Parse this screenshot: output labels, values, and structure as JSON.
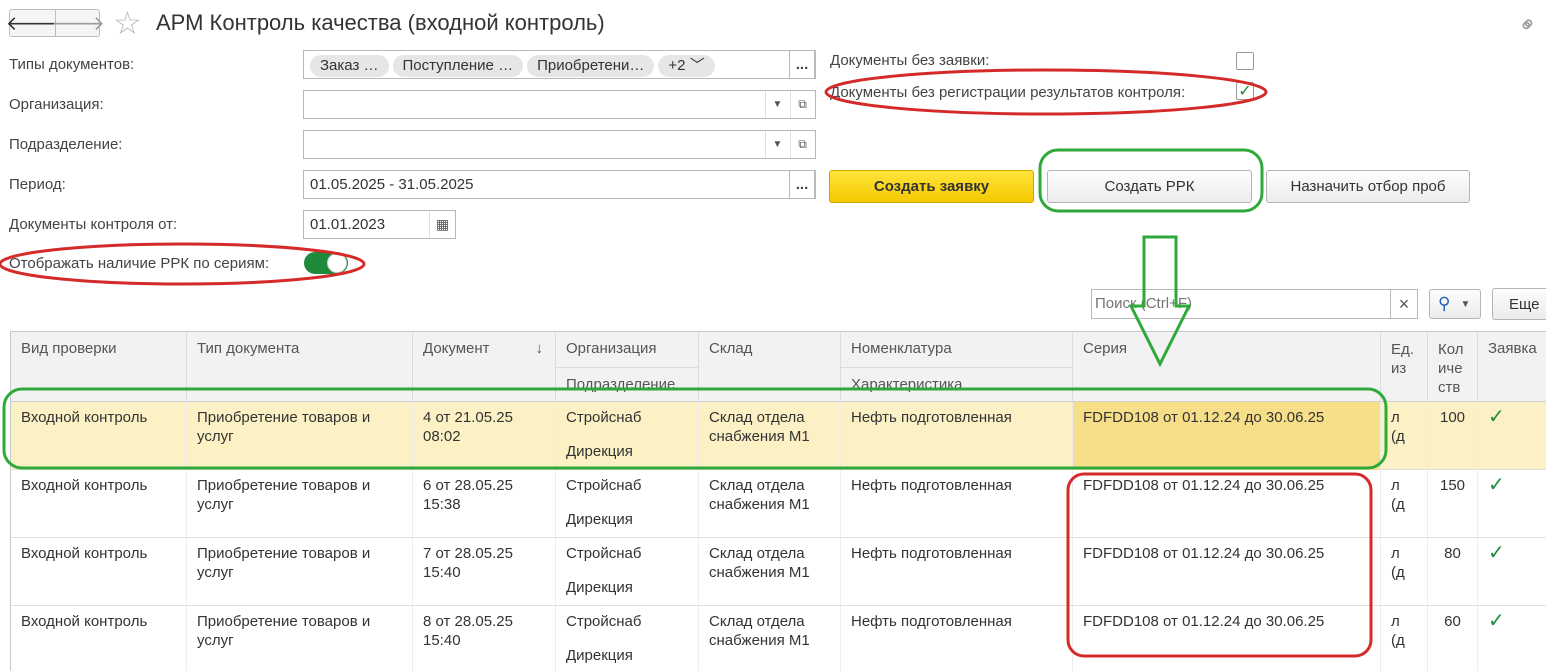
{
  "title": "АРМ Контроль качества (входной контроль)",
  "filters": {
    "doc_types_label": "Типы документов:",
    "doc_type_chips": [
      "Заказ …",
      "Поступление …",
      "Приобретени…"
    ],
    "doc_types_more": "+2",
    "org_label": "Организация:",
    "org_value": "",
    "dept_label": "Подразделение:",
    "dept_value": "",
    "period_label": "Период:",
    "period_value": "01.05.2025 - 31.05.2025",
    "control_docs_label": "Документы контроля от:",
    "control_docs_value": "01.01.2023",
    "show_rrk_label": "Отображать наличие РРК по сериям:",
    "show_rrk_on": true,
    "no_request_label": "Документы без заявки:",
    "no_request_checked": false,
    "no_results_label": "Документы без регистрации результатов контроля:",
    "no_results_checked": true
  },
  "buttons": {
    "create_request": "Создать заявку",
    "create_rrk": "Создать РРК",
    "assign_samples": "Назначить отбор проб",
    "more": "Еще",
    "dots": "...",
    "clear": "×"
  },
  "search": {
    "placeholder": "Поиск (Ctrl+F)"
  },
  "table": {
    "headers": {
      "check_type": "Вид проверки",
      "doc_type": "Тип документа",
      "document": "Документ",
      "org": "Организация",
      "dept": "Подразделение",
      "warehouse": "Склад",
      "nomenclature": "Номенклатура",
      "characteristic": "Характеристика",
      "series": "Серия",
      "unit": "Ед. из",
      "qty": "Кол иче ств",
      "request": "Заявка",
      "sort_arrow": "↓"
    },
    "rows": [
      {
        "check_type": "Входной контроль",
        "doc_type": "Приобретение товаров и услуг",
        "document": "4 от 21.05.25 08:02",
        "org": "Стройснаб",
        "dept": "Дирекция",
        "warehouse": "Склад отдела снабжения М1",
        "nomenclature": "Нефть подготовленная",
        "series": "FDFDD108 от 01.12.24 до 30.06.25",
        "unit": "л (д",
        "qty": "100",
        "request": "✓"
      },
      {
        "check_type": "Входной контроль",
        "doc_type": "Приобретение товаров и услуг",
        "document": "6 от 28.05.25 15:38",
        "org": "Стройснаб",
        "dept": "Дирекция",
        "warehouse": "Склад отдела снабжения М1",
        "nomenclature": "Нефть подготовленная",
        "series": "FDFDD108 от 01.12.24 до 30.06.25",
        "unit": "л (д",
        "qty": "150",
        "request": "✓"
      },
      {
        "check_type": "Входной контроль",
        "doc_type": "Приобретение товаров и услуг",
        "document": "7 от 28.05.25 15:40",
        "org": "Стройснаб",
        "dept": "Дирекция",
        "warehouse": "Склад отдела снабжения М1",
        "nomenclature": "Нефть подготовленная",
        "series": "FDFDD108 от 01.12.24 до 30.06.25",
        "unit": "л (д",
        "qty": "80",
        "request": "✓"
      },
      {
        "check_type": "Входной контроль",
        "doc_type": "Приобретение товаров и услуг",
        "document": "8 от 28.05.25 15:40",
        "org": "Стройснаб",
        "dept": "Дирекция",
        "warehouse": "Склад отдела снабжения М1",
        "nomenclature": "Нефть подготовленная",
        "series": "FDFDD108 от 01.12.24 до 30.06.25",
        "unit": "л (д",
        "qty": "60",
        "request": "✓"
      }
    ]
  },
  "colors": {
    "annotation_red": "#d42a2a",
    "annotation_green": "#2faa3a",
    "accent_green": "#1f8a3b",
    "selected_row": "#fbf1c4"
  }
}
